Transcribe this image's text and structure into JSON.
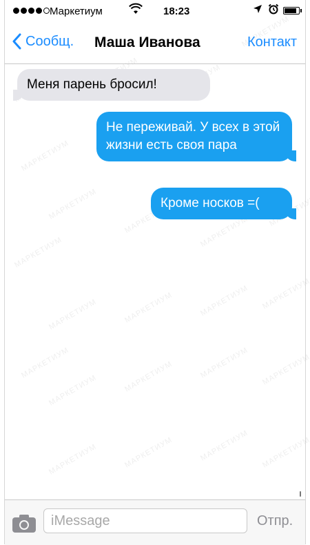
{
  "status_bar": {
    "carrier": "Маркетиум",
    "time": "18:23",
    "signal_bars": 4,
    "battery_level": 0.9
  },
  "nav": {
    "back_label": "Сообщ.",
    "title": "Маша Иванова",
    "contact_label": "Контакт"
  },
  "messages": [
    {
      "direction": "incoming",
      "text": "Меня парень бросил!"
    },
    {
      "direction": "outgoing",
      "text": "Не переживай. У всех в этой жизни есть своя пара"
    },
    {
      "direction": "outgoing",
      "text": "Кроме носков =("
    }
  ],
  "input_bar": {
    "placeholder": "iMessage",
    "send_label": "Отпр."
  },
  "watermark": "МАРКЕТИУМ",
  "colors": {
    "accent": "#1a8cff",
    "outgoing_bubble": "#1aa0f0",
    "incoming_bubble": "#e5e5ea"
  },
  "icons": [
    "wifi-icon",
    "location-arrow-icon",
    "alarm-icon",
    "battery-icon",
    "chevron-left-icon",
    "camera-icon"
  ]
}
